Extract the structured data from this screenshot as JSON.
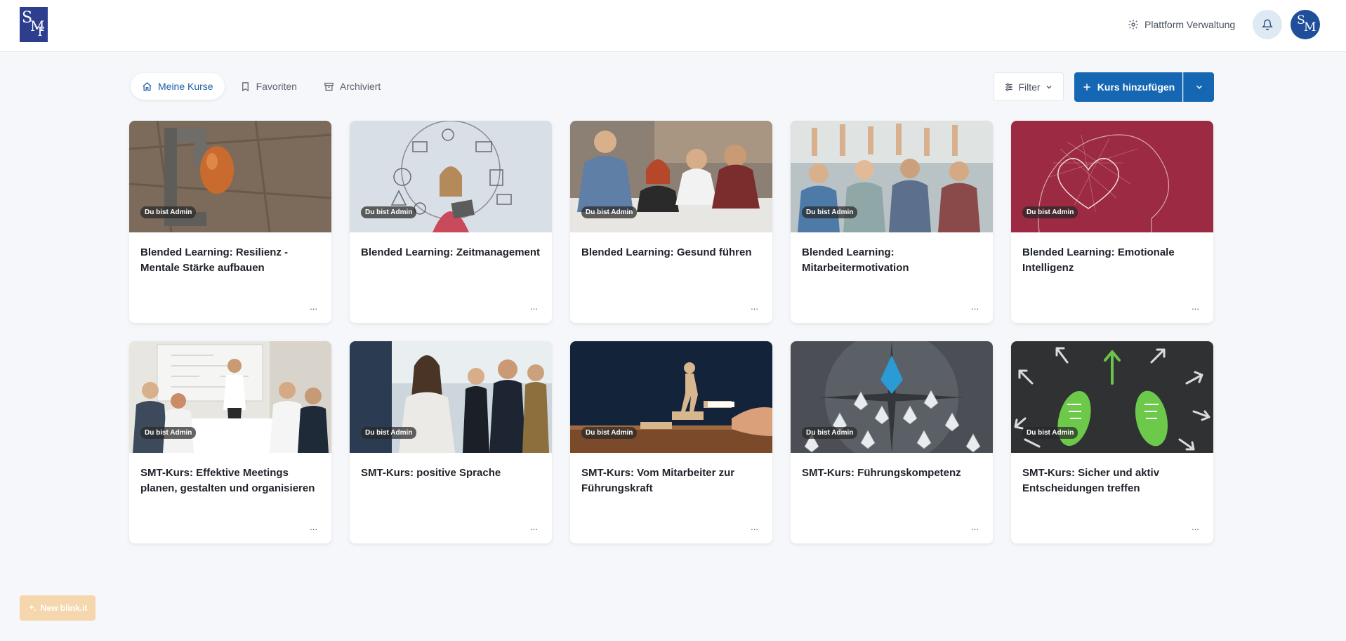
{
  "header": {
    "logo_text": [
      "S",
      "M",
      "T"
    ],
    "platform_label": "Plattform Verwaltung",
    "avatar_text": [
      "S",
      "M",
      "T"
    ]
  },
  "tabs": [
    {
      "label": "Meine Kurse",
      "icon": "home-icon",
      "active": true
    },
    {
      "label": "Favoriten",
      "icon": "bookmark-icon",
      "active": false
    },
    {
      "label": "Archiviert",
      "icon": "archive-icon",
      "active": false
    }
  ],
  "toolbar": {
    "filter_label": "Filter",
    "add_label": "Kurs hinzufügen"
  },
  "badge_label": "Du bist Admin",
  "more_label": "...",
  "courses": [
    {
      "title": "Blended Learning: Resilienz - Mentale Stärke aufbauen"
    },
    {
      "title": "Blended Learning: Zeitmanagement"
    },
    {
      "title": "Blended Learning: Gesund führen"
    },
    {
      "title": "Blended Learning: Mitarbeitermotivation"
    },
    {
      "title": "Blended Learning: Emotionale Intelligenz"
    },
    {
      "title": "SMT-Kurs: Effektive Meetings planen, gestalten und organisieren"
    },
    {
      "title": "SMT-Kurs: positive Sprache"
    },
    {
      "title": "SMT-Kurs: Vom Mitarbeiter zur Führungskraft"
    },
    {
      "title": "SMT-Kurs: Führungskompetenz"
    },
    {
      "title": "SMT-Kurs: Sicher und aktiv Entscheidungen treffen"
    }
  ],
  "new_blink_label": "New blink.it",
  "colors": {
    "primary": "#1667b3",
    "active_tab_text": "#1a5fa6",
    "badge_bg": "#282828",
    "new_blink_bg": "#f6d6ad"
  }
}
